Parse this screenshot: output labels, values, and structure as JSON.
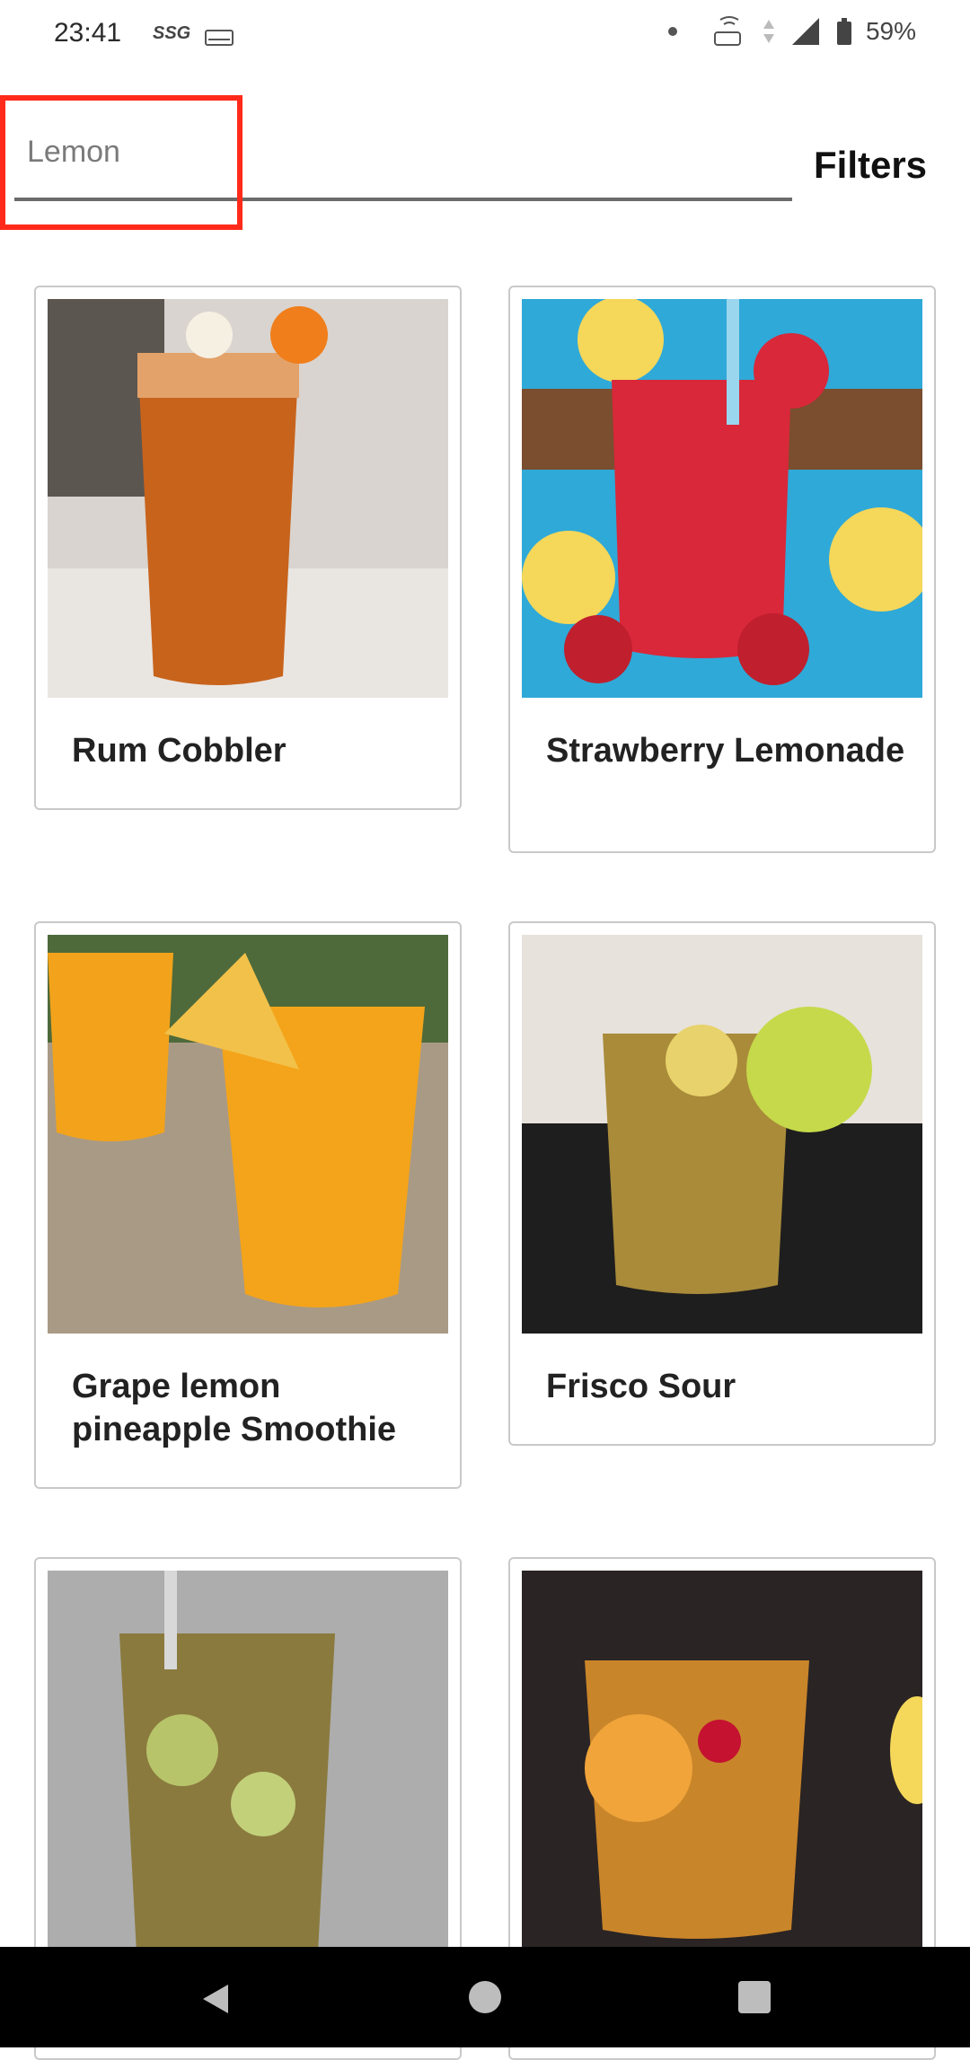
{
  "status_bar": {
    "time": "23:41",
    "brand_label": "SSG",
    "battery": "59%"
  },
  "search": {
    "value": "Lemon",
    "placeholder": ""
  },
  "filters_label": "Filters",
  "colors": {
    "highlight": "#ff2a1a",
    "underline": "#6b6b6b",
    "card_border": "#c9c9c9"
  },
  "cocktails": [
    {
      "title": "Rum Cobbler"
    },
    {
      "title": "Strawberry Lemonade"
    },
    {
      "title": "Grape lemon pineapple Smoothie"
    },
    {
      "title": "Frisco Sour"
    },
    {
      "title": ""
    },
    {
      "title": ""
    }
  ]
}
